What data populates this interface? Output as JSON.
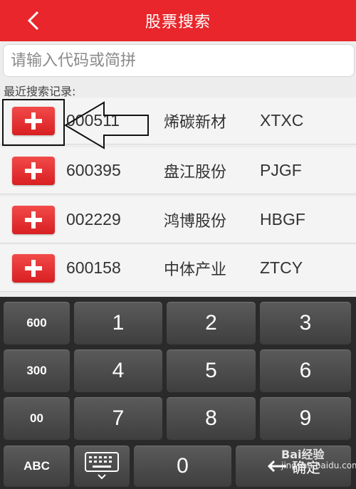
{
  "header": {
    "title": "股票搜索",
    "back_icon": "chevron-left-icon"
  },
  "search": {
    "placeholder": "请输入代码或简拼",
    "value": ""
  },
  "recent_label": "最近搜索记录:",
  "stocks": [
    {
      "code": "000511",
      "name": "烯碳新材",
      "abbr": "XTXC"
    },
    {
      "code": "600395",
      "name": "盘江股份",
      "abbr": "PJGF"
    },
    {
      "code": "002229",
      "name": "鸿博股份",
      "abbr": "HBGF"
    },
    {
      "code": "600158",
      "name": "中体产业",
      "abbr": "ZTCY"
    }
  ],
  "keyboard": {
    "side_keys": [
      "600",
      "300",
      "00",
      "ABC"
    ],
    "digits": [
      "1",
      "2",
      "3",
      "4",
      "5",
      "6",
      "7",
      "8",
      "9",
      "0"
    ],
    "confirm_label": "确定",
    "keyboard_icon": "keyboard-icon",
    "backspace_icon": "backspace-arrow-icon"
  },
  "watermark": {
    "brand": "Bai经验",
    "url": "jingyan.baidu.com"
  },
  "colors": {
    "header": "#e8262b",
    "add_button": "#e3292c",
    "keyboard_bg": "#2a2a2a"
  }
}
